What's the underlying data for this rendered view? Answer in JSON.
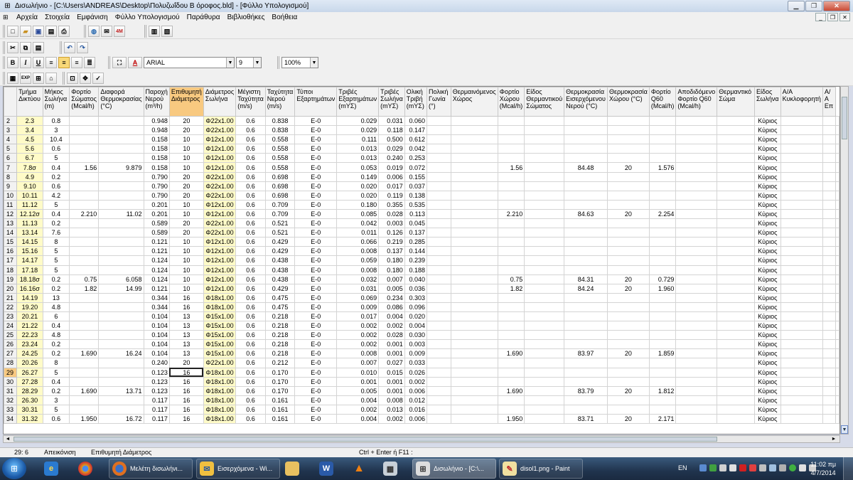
{
  "window": {
    "title": "Δισωλήνιο - [C:\\Users\\ANDREAS\\Desktop\\Πολυζωΐδου Β όροφος.bld] - [Φύλλο Υπολογισμού]"
  },
  "menu": [
    "Αρχεία",
    "Στοιχεία",
    "Εμφάνιση",
    "Φύλλο Υπολογισμού",
    "Παράθυρα",
    "Βιβλιοθήκες",
    "Βοήθεια"
  ],
  "toolbar": {
    "font": "ARIAL",
    "size": "9",
    "zoom": "100%"
  },
  "columns": [
    "Τμήμα Δικτύου",
    "Μήκος Σωλήνα (m)",
    "Φορτίο Σώματος (Mcal/h)",
    "Διαφορά Θερμοκρασίας (°C)",
    "Παροχή Νερού (m³/h)",
    "Επιθυμητή Διάμετρος",
    "Διάμετρος Σωλήνα",
    "Μέγιστη Ταχύτητα (m/s)",
    "Ταχύτητα Νερού (m/s)",
    "Τύποι Εξαρτημάτων",
    "Τριβές Εξαρτημάτων (mΥΣ)",
    "Τριβές Σωλήνα (mΥΣ)",
    "Ολική Τριβή (mΥΣ)",
    "Πολική Γωνία (°)",
    "Θερμαινόμενος Χώρος",
    "Φορτίο Χώρου (Mcal/h)",
    "Είδος Θερμαντικού Σώματος",
    "Θερμοκρασία Εισερχόμενου Νερού (°C)",
    "Θερμοκρασία Χώρου (°C)",
    "Φορτίο Q60 (Mcal/h)",
    "Αποδιδόμενο Φορτίο Q60 (Mcal/h)",
    "Θερμαντικό Σώμα",
    "Είδος Σωλήνα",
    "Α/Α Κυκλοφορητή",
    "Α/Α Επ"
  ],
  "rows": [
    {
      "n": "2",
      "c": [
        "2.3",
        "0.8",
        "",
        "",
        "0.948",
        "20",
        "Φ22x1.00",
        "0.6",
        "0.838",
        "E-0",
        "0.029",
        "0.031",
        "0.060",
        "",
        "",
        "",
        "",
        "",
        "",
        "",
        "",
        "",
        "Κύριος",
        "",
        ""
      ]
    },
    {
      "n": "3",
      "c": [
        "3.4",
        "3",
        "",
        "",
        "0.948",
        "20",
        "Φ22x1.00",
        "0.6",
        "0.838",
        "E-0",
        "0.029",
        "0.118",
        "0.147",
        "",
        "",
        "",
        "",
        "",
        "",
        "",
        "",
        "",
        "Κύριος",
        "",
        ""
      ]
    },
    {
      "n": "4",
      "c": [
        "4.5",
        "10.4",
        "",
        "",
        "0.158",
        "10",
        "Φ12x1.00",
        "0.6",
        "0.558",
        "E-0",
        "0.111",
        "0.500",
        "0.612",
        "",
        "",
        "",
        "",
        "",
        "",
        "",
        "",
        "",
        "Κύριος",
        "",
        ""
      ]
    },
    {
      "n": "5",
      "c": [
        "5.6",
        "0.6",
        "",
        "",
        "0.158",
        "10",
        "Φ12x1.00",
        "0.6",
        "0.558",
        "E-0",
        "0.013",
        "0.029",
        "0.042",
        "",
        "",
        "",
        "",
        "",
        "",
        "",
        "",
        "",
        "Κύριος",
        "",
        ""
      ]
    },
    {
      "n": "6",
      "c": [
        "6.7",
        "5",
        "",
        "",
        "0.158",
        "10",
        "Φ12x1.00",
        "0.6",
        "0.558",
        "E-0",
        "0.013",
        "0.240",
        "0.253",
        "",
        "",
        "",
        "",
        "",
        "",
        "",
        "",
        "",
        "Κύριος",
        "",
        ""
      ]
    },
    {
      "n": "7",
      "c": [
        "7.8σ",
        "0.4",
        "1.56",
        "9.879",
        "0.158",
        "10",
        "Φ12x1.00",
        "0.6",
        "0.558",
        "E-0",
        "0.053",
        "0.019",
        "0.072",
        "",
        "",
        "1.56",
        "",
        "84.48",
        "20",
        "1.576",
        "",
        "",
        "Κύριος",
        "",
        ""
      ]
    },
    {
      "n": "8",
      "c": [
        "4.9",
        "0.2",
        "",
        "",
        "0.790",
        "20",
        "Φ22x1.00",
        "0.6",
        "0.698",
        "E-0",
        "0.149",
        "0.006",
        "0.155",
        "",
        "",
        "",
        "",
        "",
        "",
        "",
        "",
        "",
        "Κύριος",
        "",
        ""
      ]
    },
    {
      "n": "9",
      "c": [
        "9.10",
        "0.6",
        "",
        "",
        "0.790",
        "20",
        "Φ22x1.00",
        "0.6",
        "0.698",
        "E-0",
        "0.020",
        "0.017",
        "0.037",
        "",
        "",
        "",
        "",
        "",
        "",
        "",
        "",
        "",
        "Κύριος",
        "",
        ""
      ]
    },
    {
      "n": "10",
      "c": [
        "10.11",
        "4.2",
        "",
        "",
        "0.790",
        "20",
        "Φ22x1.00",
        "0.6",
        "0.698",
        "E-0",
        "0.020",
        "0.119",
        "0.138",
        "",
        "",
        "",
        "",
        "",
        "",
        "",
        "",
        "",
        "Κύριος",
        "",
        ""
      ]
    },
    {
      "n": "11",
      "c": [
        "11.12",
        "5",
        "",
        "",
        "0.201",
        "10",
        "Φ12x1.00",
        "0.6",
        "0.709",
        "E-0",
        "0.180",
        "0.355",
        "0.535",
        "",
        "",
        "",
        "",
        "",
        "",
        "",
        "",
        "",
        "Κύριος",
        "",
        ""
      ]
    },
    {
      "n": "12",
      "c": [
        "12.12σ",
        "0.4",
        "2.210",
        "11.02",
        "0.201",
        "10",
        "Φ12x1.00",
        "0.6",
        "0.709",
        "E-0",
        "0.085",
        "0.028",
        "0.113",
        "",
        "",
        "2.210",
        "",
        "84.63",
        "20",
        "2.254",
        "",
        "",
        "Κύριος",
        "",
        ""
      ]
    },
    {
      "n": "13",
      "c": [
        "11.13",
        "0.2",
        "",
        "",
        "0.589",
        "20",
        "Φ22x1.00",
        "0.6",
        "0.521",
        "E-0",
        "0.042",
        "0.003",
        "0.045",
        "",
        "",
        "",
        "",
        "",
        "",
        "",
        "",
        "",
        "Κύριος",
        "",
        ""
      ]
    },
    {
      "n": "14",
      "c": [
        "13.14",
        "7.6",
        "",
        "",
        "0.589",
        "20",
        "Φ22x1.00",
        "0.6",
        "0.521",
        "E-0",
        "0.011",
        "0.126",
        "0.137",
        "",
        "",
        "",
        "",
        "",
        "",
        "",
        "",
        "",
        "Κύριος",
        "",
        ""
      ]
    },
    {
      "n": "15",
      "c": [
        "14.15",
        "8",
        "",
        "",
        "0.121",
        "10",
        "Φ12x1.00",
        "0.6",
        "0.429",
        "E-0",
        "0.066",
        "0.219",
        "0.285",
        "",
        "",
        "",
        "",
        "",
        "",
        "",
        "",
        "",
        "Κύριος",
        "",
        ""
      ]
    },
    {
      "n": "16",
      "c": [
        "15.16",
        "5",
        "",
        "",
        "0.121",
        "10",
        "Φ12x1.00",
        "0.6",
        "0.429",
        "E-0",
        "0.008",
        "0.137",
        "0.144",
        "",
        "",
        "",
        "",
        "",
        "",
        "",
        "",
        "",
        "Κύριος",
        "",
        ""
      ]
    },
    {
      "n": "17",
      "c": [
        "14.17",
        "5",
        "",
        "",
        "0.124",
        "10",
        "Φ12x1.00",
        "0.6",
        "0.438",
        "E-0",
        "0.059",
        "0.180",
        "0.239",
        "",
        "",
        "",
        "",
        "",
        "",
        "",
        "",
        "",
        "Κύριος",
        "",
        ""
      ]
    },
    {
      "n": "18",
      "c": [
        "17.18",
        "5",
        "",
        "",
        "0.124",
        "10",
        "Φ12x1.00",
        "0.6",
        "0.438",
        "E-0",
        "0.008",
        "0.180",
        "0.188",
        "",
        "",
        "",
        "",
        "",
        "",
        "",
        "",
        "",
        "Κύριος",
        "",
        ""
      ]
    },
    {
      "n": "19",
      "c": [
        "18.18σ",
        "0.2",
        "0.75",
        "6.058",
        "0.124",
        "10",
        "Φ12x1.00",
        "0.6",
        "0.438",
        "E-0",
        "0.032",
        "0.007",
        "0.040",
        "",
        "",
        "0.75",
        "",
        "84.31",
        "20",
        "0.729",
        "",
        "",
        "Κύριος",
        "",
        ""
      ]
    },
    {
      "n": "20",
      "c": [
        "16.16σ",
        "0.2",
        "1.82",
        "14.99",
        "0.121",
        "10",
        "Φ12x1.00",
        "0.6",
        "0.429",
        "E-0",
        "0.031",
        "0.005",
        "0.036",
        "",
        "",
        "1.82",
        "",
        "84.24",
        "20",
        "1.960",
        "",
        "",
        "Κύριος",
        "",
        ""
      ]
    },
    {
      "n": "21",
      "c": [
        "14.19",
        "13",
        "",
        "",
        "0.344",
        "16",
        "Φ18x1.00",
        "0.6",
        "0.475",
        "E-0",
        "0.069",
        "0.234",
        "0.303",
        "",
        "",
        "",
        "",
        "",
        "",
        "",
        "",
        "",
        "Κύριος",
        "",
        ""
      ]
    },
    {
      "n": "22",
      "c": [
        "19.20",
        "4.8",
        "",
        "",
        "0.344",
        "16",
        "Φ18x1.00",
        "0.6",
        "0.475",
        "E-0",
        "0.009",
        "0.086",
        "0.096",
        "",
        "",
        "",
        "",
        "",
        "",
        "",
        "",
        "",
        "Κύριος",
        "",
        ""
      ]
    },
    {
      "n": "23",
      "c": [
        "20.21",
        "6",
        "",
        "",
        "0.104",
        "13",
        "Φ15x1.00",
        "0.6",
        "0.218",
        "E-0",
        "0.017",
        "0.004",
        "0.020",
        "",
        "",
        "",
        "",
        "",
        "",
        "",
        "",
        "",
        "Κύριος",
        "",
        ""
      ]
    },
    {
      "n": "24",
      "c": [
        "21.22",
        "0.4",
        "",
        "",
        "0.104",
        "13",
        "Φ15x1.00",
        "0.6",
        "0.218",
        "E-0",
        "0.002",
        "0.002",
        "0.004",
        "",
        "",
        "",
        "",
        "",
        "",
        "",
        "",
        "",
        "Κύριος",
        "",
        ""
      ]
    },
    {
      "n": "25",
      "c": [
        "22.23",
        "4.8",
        "",
        "",
        "0.104",
        "13",
        "Φ15x1.00",
        "0.6",
        "0.218",
        "E-0",
        "0.002",
        "0.028",
        "0.030",
        "",
        "",
        "",
        "",
        "",
        "",
        "",
        "",
        "",
        "Κύριος",
        "",
        ""
      ]
    },
    {
      "n": "26",
      "c": [
        "23.24",
        "0.2",
        "",
        "",
        "0.104",
        "13",
        "Φ15x1.00",
        "0.6",
        "0.218",
        "E-0",
        "0.002",
        "0.001",
        "0.003",
        "",
        "",
        "",
        "",
        "",
        "",
        "",
        "",
        "",
        "Κύριος",
        "",
        ""
      ]
    },
    {
      "n": "27",
      "c": [
        "24.25",
        "0.2",
        "1.690",
        "16.24",
        "0.104",
        "13",
        "Φ15x1.00",
        "0.6",
        "0.218",
        "E-0",
        "0.008",
        "0.001",
        "0.009",
        "",
        "",
        "1.690",
        "",
        "83.97",
        "20",
        "1.859",
        "",
        "",
        "Κύριος",
        "",
        ""
      ]
    },
    {
      "n": "28",
      "c": [
        "20.26",
        "8",
        "",
        "",
        "0.240",
        "20",
        "Φ22x1.00",
        "0.6",
        "0.212",
        "E-0",
        "0.007",
        "0.027",
        "0.033",
        "",
        "",
        "",
        "",
        "",
        "",
        "",
        "",
        "",
        "Κύριος",
        "",
        ""
      ]
    },
    {
      "n": "29",
      "c": [
        "26.27",
        "5",
        "",
        "",
        "0.123",
        "16",
        "Φ18x1.00",
        "0.6",
        "0.170",
        "E-0",
        "0.010",
        "0.015",
        "0.026",
        "",
        "",
        "",
        "",
        "",
        "",
        "",
        "",
        "",
        "Κύριος",
        "",
        ""
      ]
    },
    {
      "n": "30",
      "c": [
        "27.28",
        "0.4",
        "",
        "",
        "0.123",
        "16",
        "Φ18x1.00",
        "0.6",
        "0.170",
        "E-0",
        "0.001",
        "0.001",
        "0.002",
        "",
        "",
        "",
        "",
        "",
        "",
        "",
        "",
        "",
        "Κύριος",
        "",
        ""
      ]
    },
    {
      "n": "31",
      "c": [
        "28.29",
        "0.2",
        "1.690",
        "13.71",
        "0.123",
        "16",
        "Φ18x1.00",
        "0.6",
        "0.170",
        "E-0",
        "0.005",
        "0.001",
        "0.006",
        "",
        "",
        "1.690",
        "",
        "83.79",
        "20",
        "1.812",
        "",
        "",
        "Κύριος",
        "",
        ""
      ]
    },
    {
      "n": "32",
      "c": [
        "26.30",
        "3",
        "",
        "",
        "0.117",
        "16",
        "Φ18x1.00",
        "0.6",
        "0.161",
        "E-0",
        "0.004",
        "0.008",
        "0.012",
        "",
        "",
        "",
        "",
        "",
        "",
        "",
        "",
        "",
        "Κύριος",
        "",
        ""
      ]
    },
    {
      "n": "33",
      "c": [
        "30.31",
        "5",
        "",
        "",
        "0.117",
        "16",
        "Φ18x1.00",
        "0.6",
        "0.161",
        "E-0",
        "0.002",
        "0.013",
        "0.016",
        "",
        "",
        "",
        "",
        "",
        "",
        "",
        "",
        "",
        "Κύριος",
        "",
        ""
      ]
    },
    {
      "n": "34",
      "c": [
        "31.32",
        "0.6",
        "1.950",
        "16.72",
        "0.117",
        "16",
        "Φ18x1.00",
        "0.6",
        "0.161",
        "E-0",
        "0.004",
        "0.002",
        "0.006",
        "",
        "",
        "1.950",
        "",
        "83.71",
        "20",
        "2.171",
        "",
        "",
        "Κύριος",
        "",
        ""
      ]
    }
  ],
  "status": {
    "cell": "29: 6",
    "mode": "Απεικόνιση",
    "field": "Επιθυμητή Διάμετρος",
    "hint": "Ctrl + Enter ή F11 :"
  },
  "taskbar": {
    "apps": [
      "Μελέτη δισωλήνι...",
      "Εισερχόμενα - Wi...",
      "Δισωλήνιο - [C:\\...",
      "disol1.png - Paint"
    ],
    "lang": "EN",
    "time": "11:02 πμ",
    "date": "4/7/2014"
  },
  "colors": {
    "selected_header": "#f8c980",
    "yellow_column": "#fffbc8"
  }
}
